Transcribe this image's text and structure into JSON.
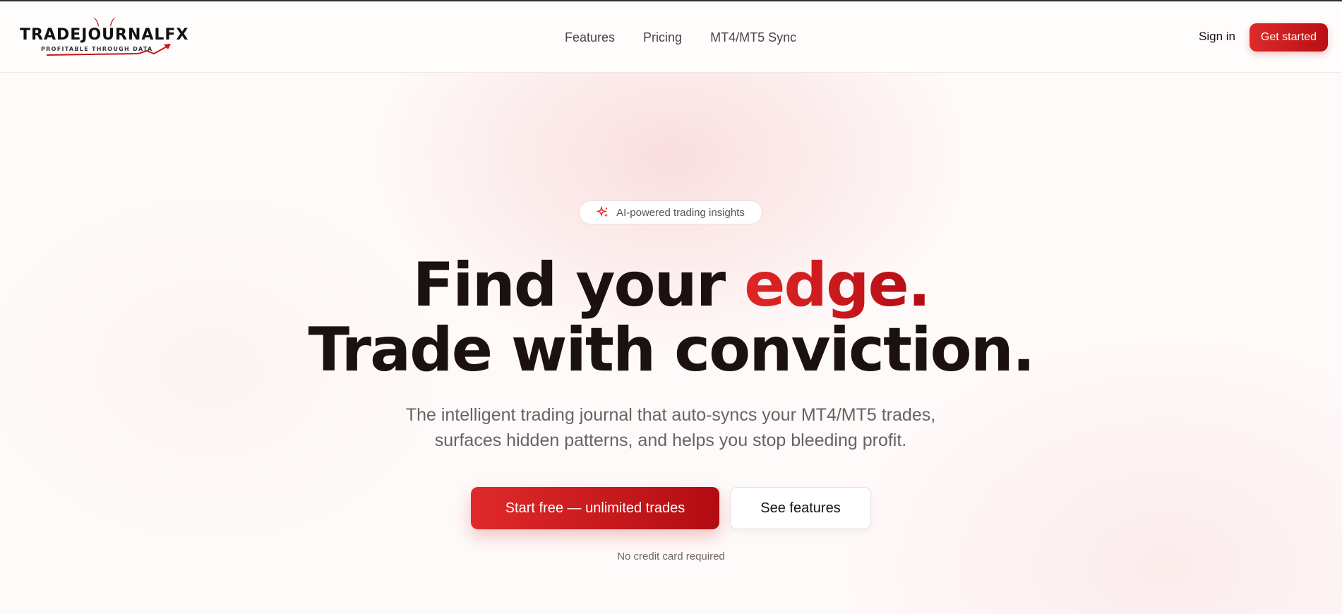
{
  "brand": {
    "name": "TRADEJOURNALFX",
    "tagline": "PROFITABLE THROUGH DATA",
    "accent_color": "#c8161b"
  },
  "nav": {
    "items": [
      {
        "label": "Features"
      },
      {
        "label": "Pricing"
      },
      {
        "label": "MT4/MT5 Sync"
      }
    ],
    "sign_in": "Sign in",
    "get_started": "Get started"
  },
  "hero": {
    "badge": {
      "icon": "sparkle-icon",
      "text": "AI-powered trading insights"
    },
    "headline_line1_start": "Find your ",
    "headline_line1_accent": "edge.",
    "headline_line2": "Trade with conviction.",
    "subtitle_line1": "The intelligent trading journal that auto-syncs your MT4/MT5 trades,",
    "subtitle_line2": "surfaces hidden patterns, and helps you stop bleeding profit.",
    "cta_primary": "Start free — unlimited trades",
    "cta_secondary": "See features",
    "note": "No credit card required"
  }
}
